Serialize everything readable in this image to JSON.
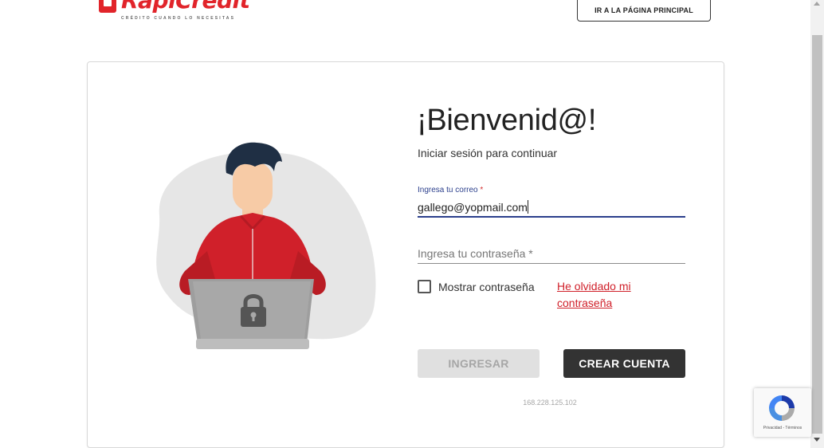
{
  "header": {
    "logo_text": "RapiCredit",
    "logo_tagline": "CRÉDITO CUANDO LO NECESITAS",
    "home_button_label": "IR A LA PÁGINA PRINCIPAL"
  },
  "login": {
    "title": "¡Bienvenid@!",
    "subtitle": "Iniciar sesión para continuar",
    "email_label": "Ingresa tu correo",
    "required_mark": "*",
    "email_value": "gallego@yopmail.com",
    "password_placeholder": "Ingresa tu contraseña *",
    "show_password_label": "Mostrar contraseña",
    "forgot_password_link": "He olvidado mi contraseña",
    "login_button_label": "INGRESAR",
    "create_account_button_label": "CREAR CUENTA",
    "ip_address": "168.228.125.102"
  },
  "recaptcha": {
    "links": "Privacidad - Términos"
  },
  "illustration": {
    "icon": "person-with-locked-laptop",
    "colors": {
      "shirt": "#d0202a",
      "blob": "#e6e6e6",
      "laptop": "#9e9e9e"
    }
  },
  "colors": {
    "brand_red": "#e1242a",
    "focus_blue": "#2b3f8c",
    "dark_button": "#333333",
    "disabled_button": "#e0e0e0"
  }
}
